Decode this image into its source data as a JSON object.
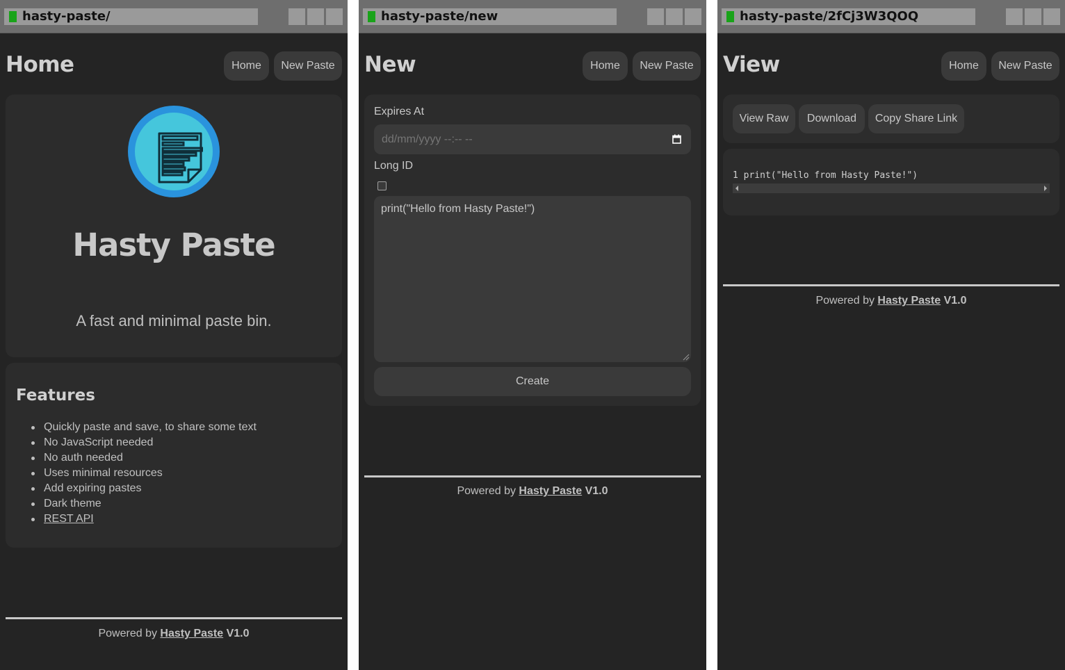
{
  "windows": {
    "home": {
      "url": "hasty-paste/",
      "title": "Home",
      "nav": {
        "home": "Home",
        "new_paste": "New Paste"
      },
      "brand": "Hasty Paste",
      "tagline": "A fast and minimal paste bin.",
      "features_title": "Features",
      "features": [
        "Quickly paste and save, to share some text",
        "No JavaScript needed",
        "No auth needed",
        "Uses minimal resources",
        "Add expiring pastes",
        "Dark theme",
        "REST API"
      ]
    },
    "new": {
      "url": "hasty-paste/new",
      "title": "New",
      "nav": {
        "home": "Home",
        "new_paste": "New Paste"
      },
      "expires_label": "Expires At",
      "expires_placeholder": "dd/mm/yyyy --:-- --",
      "long_id_label": "Long ID",
      "long_id_checked": false,
      "content": "print(\"Hello from Hasty Paste!\")",
      "create_label": "Create"
    },
    "view": {
      "url": "hasty-paste/2fCj3W3QOQ",
      "title": "View",
      "nav": {
        "home": "Home",
        "new_paste": "New Paste"
      },
      "actions": {
        "view_raw": "View Raw",
        "download": "Download",
        "copy_share_link": "Copy Share Link"
      },
      "code_line_number": "1",
      "code_text": "print(\"Hello from Hasty Paste!\")"
    }
  },
  "footer": {
    "prefix": "Powered by",
    "link": "Hasty Paste",
    "version": "V1.0"
  },
  "colors": {
    "background": "#242424",
    "card": "#2c2c2c",
    "button": "#3a3a3a",
    "favicon": "#19a319",
    "logo_outer": "#2a93dd",
    "logo_inner": "#45c6dc"
  }
}
